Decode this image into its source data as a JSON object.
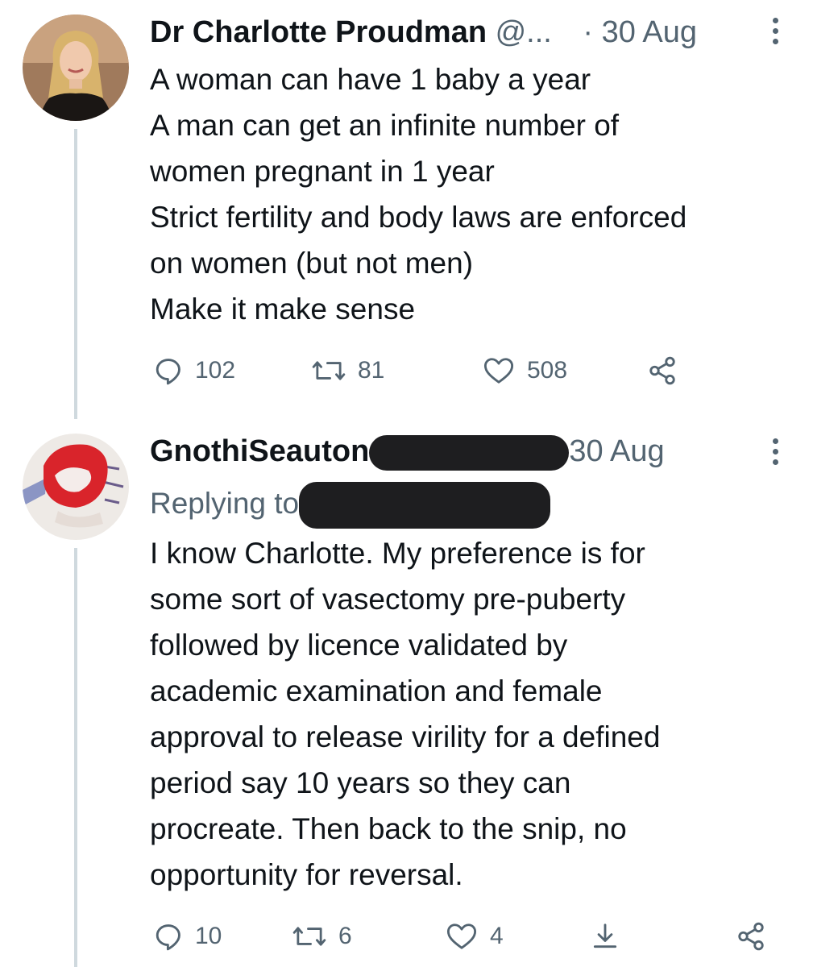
{
  "tweets": [
    {
      "author_name": "Dr Charlotte Proudman",
      "handle": "@...",
      "separator": "·",
      "date": "30 Aug",
      "text": "A woman can have 1 baby a year\nA man can get an infinite number of\nwomen pregnant in 1 year\nStrict fertility and body laws are enforced\non women (but not men)\nMake it make sense",
      "replies": "102",
      "retweets": "81",
      "likes": "508",
      "avatar_icon": "profile-photo",
      "actions_icons": [
        "reply-icon",
        "retweet-icon",
        "like-icon",
        "share-icon"
      ]
    },
    {
      "author_name": "GnothiSeauton",
      "date": "30 Aug",
      "replying_label": "Replying to",
      "text": "I know Charlotte. My preference is for\nsome sort of vasectomy pre-puberty\nfollowed by licence validated by\nacademic examination and female\napproval to release virility for a defined\nperiod say 10 years so they can\nprocreate. Then back to the snip, no\nopportunity for reversal.",
      "replies": "10",
      "retweets": "6",
      "likes": "4",
      "avatar_icon": "profile-photo",
      "actions_icons": [
        "reply-icon",
        "retweet-icon",
        "like-icon",
        "download-icon",
        "share-icon"
      ]
    }
  ],
  "colors": {
    "text_primary": "#0f1419",
    "text_secondary": "#536471",
    "thread_line": "#cfd9de",
    "redaction": "#1e1e20"
  }
}
